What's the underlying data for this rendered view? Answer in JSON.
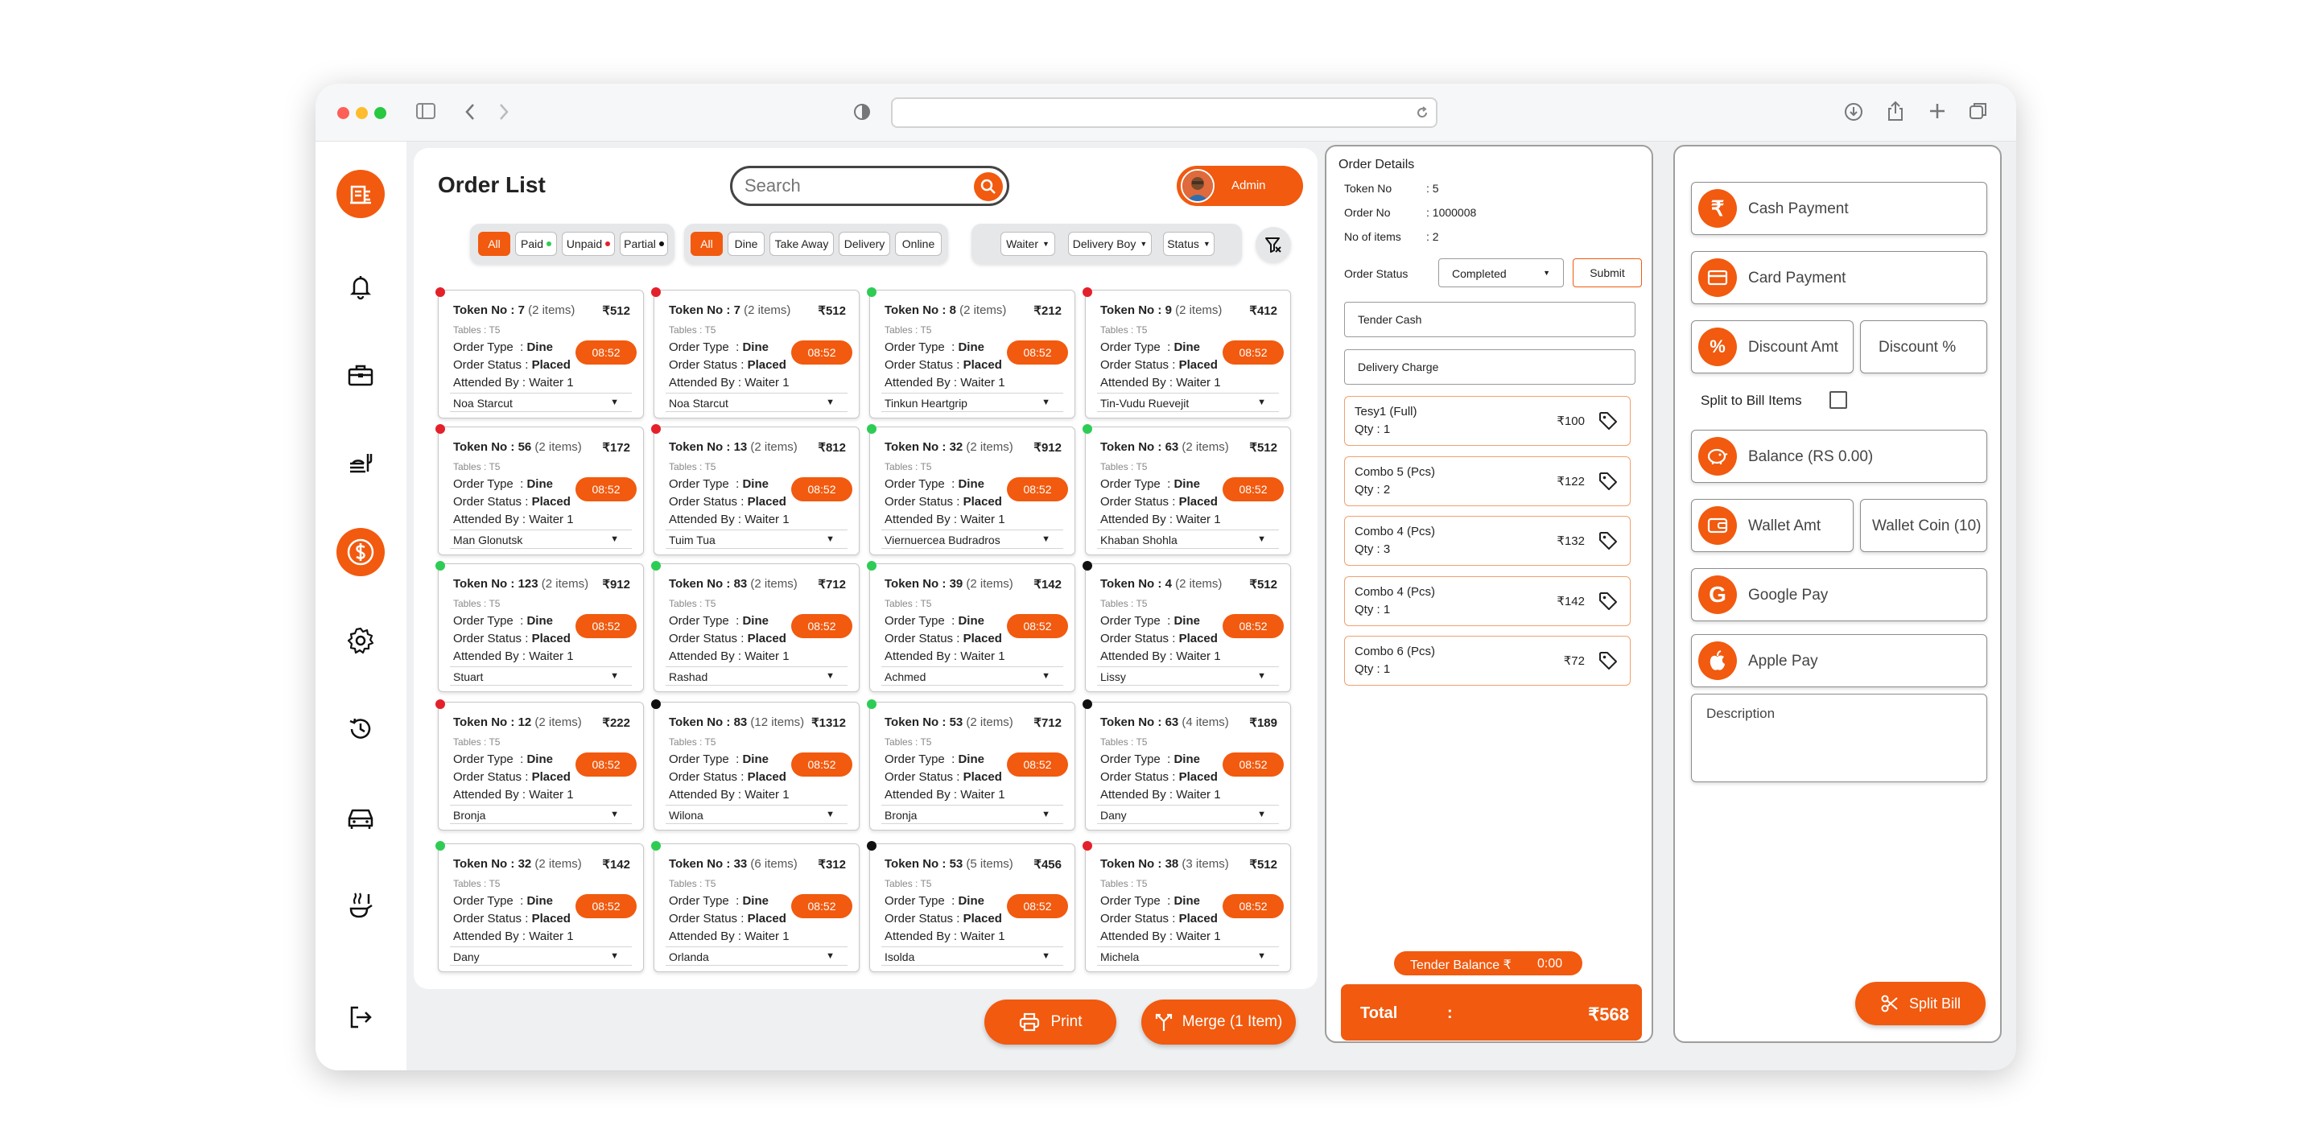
{
  "colors": {
    "accent": "#f15a0f",
    "status_red": "#e4202a",
    "status_green": "#2ecc55",
    "status_black": "#111111"
  },
  "page": {
    "title": "Order List",
    "search_placeholder": "Search",
    "admin_label": "Admin"
  },
  "sidebar": {
    "items": [
      "logo-icon",
      "bell-icon",
      "briefcase-icon",
      "food-tray-icon",
      "dollar-icon",
      "settings-icon",
      "history-icon",
      "car-icon",
      "kitchen-icon",
      "logout-icon"
    ],
    "active": "dollar-icon"
  },
  "filters": {
    "payment": [
      {
        "label": "All",
        "active": true,
        "dot": ""
      },
      {
        "label": "Paid",
        "active": false,
        "dot": "green"
      },
      {
        "label": "Unpaid",
        "active": false,
        "dot": "red"
      },
      {
        "label": "Partial",
        "active": false,
        "dot": "black"
      }
    ],
    "type": [
      {
        "label": "All",
        "active": true
      },
      {
        "label": "Dine",
        "active": false
      },
      {
        "label": "Take Away",
        "active": false
      },
      {
        "label": "Delivery",
        "active": false
      },
      {
        "label": "Online",
        "active": false
      }
    ],
    "dropdowns": [
      "Waiter",
      "Delivery Boy",
      "Status"
    ]
  },
  "card_labels": {
    "order_type": "Order Type",
    "order_status": "Order Status",
    "attended_by": "Attended By",
    "token_prefix": "Token No :",
    "type_value": "Dine",
    "status_value": "Placed",
    "waiter_value": "Waiter 1",
    "table_value": "Tables : T5",
    "time": "08:52"
  },
  "orders": [
    {
      "token": "7",
      "items": "(2 items)",
      "amount": "₹512",
      "waiter": "Noa Starcut",
      "status": "red"
    },
    {
      "token": "7",
      "items": "(2 items)",
      "amount": "₹512",
      "waiter": "Noa Starcut",
      "status": "red"
    },
    {
      "token": "8",
      "items": "(2 items)",
      "amount": "₹212",
      "waiter": "Tinkun Heartgrip",
      "status": "green"
    },
    {
      "token": "9",
      "items": "(2 items)",
      "amount": "₹412",
      "waiter": "Tin-Vudu Ruevejit",
      "status": "red"
    },
    {
      "token": "56",
      "items": "(2 items)",
      "amount": "₹172",
      "waiter": "Man Glonutsk",
      "status": "red"
    },
    {
      "token": "13",
      "items": "(2 items)",
      "amount": "₹812",
      "waiter": "Tuim Tua",
      "status": "red"
    },
    {
      "token": "32",
      "items": "(2 items)",
      "amount": "₹912",
      "waiter": "Viernuercea Budradros",
      "status": "green"
    },
    {
      "token": "63",
      "items": "(2 items)",
      "amount": "₹512",
      "waiter": "Khaban Shohla",
      "status": "green"
    },
    {
      "token": "123",
      "items": "(2 items)",
      "amount": "₹912",
      "waiter": "Stuart",
      "status": "green"
    },
    {
      "token": "83",
      "items": "(2 items)",
      "amount": "₹712",
      "waiter": "Rashad",
      "status": "green"
    },
    {
      "token": "39",
      "items": "(2 items)",
      "amount": "₹142",
      "waiter": "Achmed",
      "status": "green"
    },
    {
      "token": "4",
      "items": "(2 items)",
      "amount": "₹512",
      "waiter": "Lissy",
      "status": "black"
    },
    {
      "token": "12",
      "items": "(2 items)",
      "amount": "₹222",
      "waiter": "Bronja",
      "status": "red"
    },
    {
      "token": "83",
      "items": "(12 items)",
      "amount": "₹1312",
      "waiter": "Wilona",
      "status": "black"
    },
    {
      "token": "53",
      "items": "(2 items)",
      "amount": "₹712",
      "waiter": "Bronja",
      "status": "green"
    },
    {
      "token": "63",
      "items": "(4 items)",
      "amount": "₹189",
      "waiter": "Dany",
      "status": "black"
    },
    {
      "token": "32",
      "items": "(2 items)",
      "amount": "₹142",
      "waiter": "Dany",
      "status": "green"
    },
    {
      "token": "33",
      "items": "(6 items)",
      "amount": "₹312",
      "waiter": "Orlanda",
      "status": "green"
    },
    {
      "token": "53",
      "items": "(5 items)",
      "amount": "₹456",
      "waiter": "Isolda",
      "status": "black"
    },
    {
      "token": "38",
      "items": "(3 items)",
      "amount": "₹512",
      "waiter": "Michela",
      "status": "red"
    }
  ],
  "actions": {
    "print": "Print",
    "merge": "Merge (1 Item)"
  },
  "details": {
    "title": "Order Details",
    "token_label": "Token No",
    "token_value": ": 5",
    "order_label": "Order No",
    "order_value": ": 1000008",
    "items_label": "No of items",
    "items_value": ": 2",
    "status_label": "Order Status",
    "status_value": "Completed",
    "submit": "Submit",
    "tender_cash": "Tender Cash",
    "delivery_charge": "Delivery Charge",
    "items": [
      {
        "name": "Tesy1 (Full)",
        "qty": "Qty : 1",
        "price": "₹100"
      },
      {
        "name": "Combo 5 (Pcs)",
        "qty": "Qty : 2",
        "price": "₹122"
      },
      {
        "name": "Combo 4 (Pcs)",
        "qty": "Qty : 3",
        "price": "₹132"
      },
      {
        "name": "Combo 4 (Pcs)",
        "qty": "Qty : 1",
        "price": "₹142"
      },
      {
        "name": "Combo 6 (Pcs)",
        "qty": "Qty : 1",
        "price": "₹72"
      }
    ],
    "tender_balance_label": "Tender Balance ₹",
    "tender_balance_value": "0:00",
    "total_label": "Total",
    "total_sep": ":",
    "total_value": "₹568"
  },
  "payment": {
    "cash": "Cash Payment",
    "card": "Card Payment",
    "discount_amt": "Discount Amt",
    "discount_pct": "Discount %",
    "split_items": "Split to Bill Items",
    "balance": "Balance (RS 0.00)",
    "wallet_amt": "Wallet Amt",
    "wallet_coin": "Wallet Coin (10)",
    "google": "Google Pay",
    "apple": "Apple Pay",
    "description_placeholder": "Description",
    "split_bill": "Split Bill"
  }
}
